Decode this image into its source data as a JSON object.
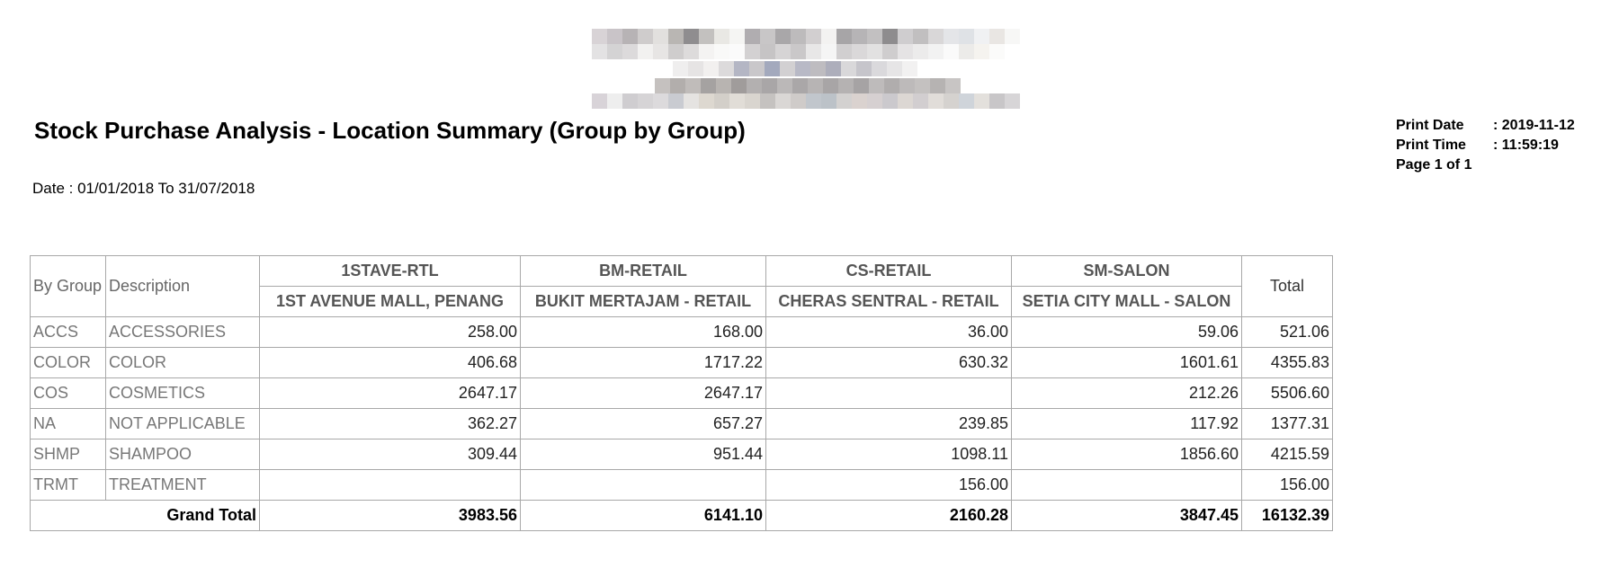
{
  "report": {
    "title": "Stock Purchase Analysis - Location Summary (Group by Group)",
    "date_range": "Date : 01/01/2018 To 31/07/2018"
  },
  "print_info": {
    "date_label": "Print Date",
    "date_value": ": 2019-11-12",
    "time_label": "Print Time",
    "time_value": ": 11:59:19",
    "page": "Page 1 of 1"
  },
  "table": {
    "headers": {
      "group": "By Group",
      "description": "Description",
      "total": "Total"
    },
    "locations": [
      {
        "code": "1STAVE-RTL",
        "name": "1ST AVENUE MALL, PENANG"
      },
      {
        "code": "BM-RETAIL",
        "name": "BUKIT MERTAJAM - RETAIL"
      },
      {
        "code": "CS-RETAIL",
        "name": "CHERAS SENTRAL - RETAIL"
      },
      {
        "code": "SM-SALON",
        "name": "SETIA CITY MALL - SALON"
      }
    ],
    "rows": [
      {
        "group": "ACCS",
        "description": "ACCESSORIES",
        "values": [
          "258.00",
          "168.00",
          "36.00",
          "59.06"
        ],
        "total": "521.06"
      },
      {
        "group": "COLOR",
        "description": "COLOR",
        "values": [
          "406.68",
          "1717.22",
          "630.32",
          "1601.61"
        ],
        "total": "4355.83"
      },
      {
        "group": "COS",
        "description": "COSMETICS",
        "values": [
          "2647.17",
          "2647.17",
          "",
          "212.26"
        ],
        "total": "5506.60"
      },
      {
        "group": "NA",
        "description": "NOT APPLICABLE",
        "values": [
          "362.27",
          "657.27",
          "239.85",
          "117.92"
        ],
        "total": "1377.31"
      },
      {
        "group": "SHMP",
        "description": "SHAMPOO",
        "values": [
          "309.44",
          "951.44",
          "1098.11",
          "1856.60"
        ],
        "total": "4215.59"
      },
      {
        "group": "TRMT",
        "description": "TREATMENT",
        "values": [
          "",
          "",
          "156.00",
          ""
        ],
        "total": "156.00"
      }
    ],
    "grand_total": {
      "label": "Grand Total",
      "values": [
        "3983.56",
        "6141.10",
        "2160.28",
        "3847.45"
      ],
      "total": "16132.39"
    }
  },
  "colors": {
    "border": "#a8a8a8",
    "muted_text": "#777777"
  }
}
